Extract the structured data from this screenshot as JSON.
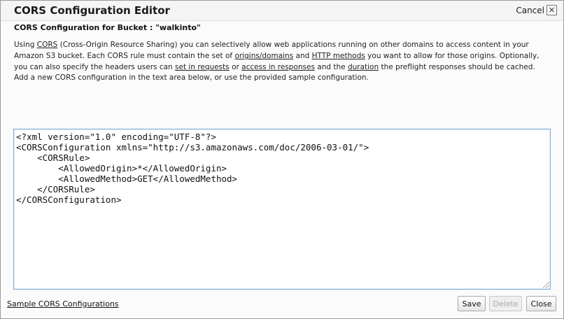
{
  "dialog": {
    "title": "CORS Configuration Editor",
    "cancel_label": "Cancel",
    "close_glyph": "×"
  },
  "subtitle": "CORS Configuration for Bucket : \"walkinto\"",
  "description": {
    "p1": "Using ",
    "l1": "CORS",
    "p2": " (Cross-Origin Resource Sharing) you can selectively allow web applications running on other domains to access content in your Amazon S3 bucket. Each CORS rule must contain the set of ",
    "l2": "origins/domains",
    "p3": " and ",
    "l3": "HTTP methods",
    "p4": " you want to allow for those origins. Optionally, you can also specify the headers users can ",
    "l4": "set in requests",
    "p5": " or ",
    "l5": "access in responses",
    "p6": " and the ",
    "l6": "duration",
    "p7": " the preflight responses should be cached."
  },
  "add_text": "Add a new CORS configuration in the text area below, or use the provided sample configuration.",
  "editor": {
    "lines": [
      "<?xml version=\"1.0\" encoding=\"UTF-8\"?>",
      "<CORSConfiguration xmlns=\"http://s3.amazonaws.com/doc/2006-03-01/\">",
      "    <CORSRule>",
      "        <AllowedOrigin>*</AllowedOrigin>",
      "        <AllowedMethod>GET</AllowedMethod>",
      "    </CORSRule>",
      "</CORSConfiguration>"
    ]
  },
  "footer": {
    "sample_link": "Sample CORS Configurations",
    "save_label": "Save",
    "delete_label": "Delete",
    "close_label": "Close"
  },
  "colors": {
    "editor_border": "#7fa8d6",
    "background": "#fbfbfb"
  }
}
